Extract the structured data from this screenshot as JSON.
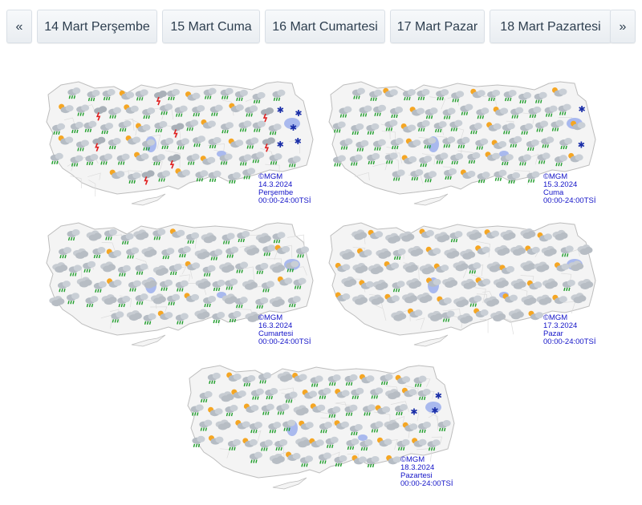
{
  "nav": {
    "prev_label": "«",
    "next_label": "»",
    "days": [
      "14 Mart Perşembe",
      "15 Mart Cuma",
      "16 Mart Cumartesi",
      "17 Mart Pazar",
      "18 Mart Pazartesi"
    ]
  },
  "maps": [
    {
      "credit": "©MGM",
      "date": "14.3.2024",
      "day": "Perşembe",
      "period": "00:00-24:00TSİ"
    },
    {
      "credit": "©MGM",
      "date": "15.3.2024",
      "day": "Cuma",
      "period": "00:00-24:00TSİ"
    },
    {
      "credit": "©MGM",
      "date": "16.3.2024",
      "day": "Cumartesi",
      "period": "00:00-24:00TSİ"
    },
    {
      "credit": "©MGM",
      "date": "17.3.2024",
      "day": "Pazar",
      "period": "00:00-24:00TSİ"
    },
    {
      "credit": "©MGM",
      "date": "18.3.2024",
      "day": "Pazartesi",
      "period": "00:00-24:00TSİ"
    }
  ],
  "icons": {
    "rain": "rain-cloud-icon",
    "snow": "snow-icon",
    "sun_cloud": "sun-behind-cloud-icon",
    "thunder": "thunderstorm-icon",
    "cloudy": "cloudy-icon"
  },
  "colors": {
    "map_fill": "#f4f4f4",
    "border": "#bdbdbd",
    "lake": "#a9b9ee",
    "caption_text": "#1414c8",
    "rain_drop": "#1f9e2b",
    "thunder": "#e02020",
    "sun": "#f5a623",
    "snow": "#1a2ea8"
  }
}
